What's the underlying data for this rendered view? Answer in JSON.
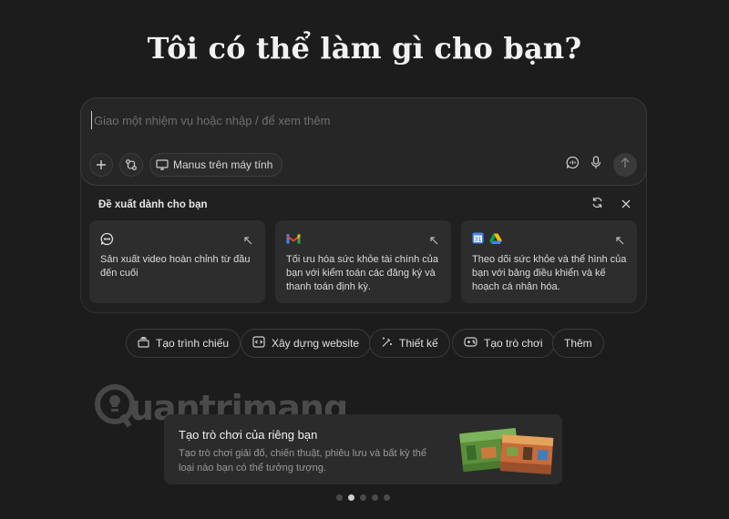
{
  "headline": "Tôi có thể làm gì cho bạn?",
  "composer": {
    "placeholder": "Giao một nhiệm vụ hoặc nhập / để xem thêm",
    "computer_button": "Manus trên máy tính",
    "icons": [
      "plus-icon",
      "connectors-icon",
      "monitor-icon",
      "voice-chat-icon",
      "microphone-icon",
      "send-arrow-icon"
    ]
  },
  "suggestions": {
    "title": "Đề xuất dành cho bạn",
    "cards": [
      {
        "icon": "chat-bubble-icon",
        "text": "Sản xuất video hoàn chỉnh từ đầu đến cuối"
      },
      {
        "icon": "gmail-icon",
        "text": "Tối ưu hóa sức khỏe tài chính của bạn với kiểm toán các đăng ký và thanh toán định kỳ."
      },
      {
        "icon": "calendar-icon",
        "icon2": "google-drive-icon",
        "text": "Theo dõi sức khỏe và thể hình của bạn với bảng điều khiển và kế hoạch cá nhân hóa."
      }
    ]
  },
  "chips": [
    {
      "label": "Tạo trình chiếu",
      "icon": "slides-icon"
    },
    {
      "label": "Xây dựng website",
      "icon": "code-window-icon"
    },
    {
      "label": "Thiết kế",
      "icon": "magic-wand-icon"
    },
    {
      "label": "Tạo trò chơi",
      "icon": "gamepad-icon"
    },
    {
      "label": "Thêm",
      "icon": ""
    }
  ],
  "watermark": "uantrimang",
  "banner": {
    "title": "Tạo trò chơi của riêng bạn",
    "description": "Tạo trò chơi giải đố, chiến thuật, phiêu lưu và bất kỳ thể loại nào bạn có thể tưởng tượng."
  },
  "carousel": {
    "count": 5,
    "active_index": 1
  },
  "colors": {
    "background": "#1c1c1c",
    "composer": "#262626",
    "card": "#2d2d2d",
    "gmail_red": "#ea4335"
  }
}
